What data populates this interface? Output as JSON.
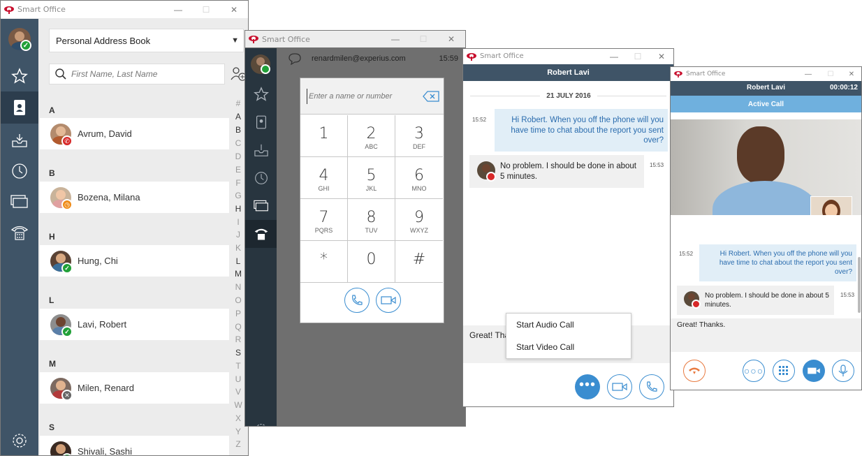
{
  "app": {
    "title": "Smart Office"
  },
  "colors": {
    "nav": "#3f5467",
    "accent": "#3a8dd0",
    "online": "#21a038",
    "busy": "#d72828",
    "away": "#ef8b18",
    "bubble": "#e1eef7"
  },
  "address_book": {
    "selector_value": "Personal Address Book",
    "search_placeholder": "First Name, Last Name",
    "sections": [
      {
        "letter": "A",
        "contact": "Avrum, David",
        "status": "busy"
      },
      {
        "letter": "B",
        "contact": "Bozena, Milana",
        "status": "away"
      },
      {
        "letter": "H",
        "contact": "Hung, Chi",
        "status": "online"
      },
      {
        "letter": "L",
        "contact": "Lavi, Robert",
        "status": "online"
      },
      {
        "letter": "M",
        "contact": "Milen, Renard",
        "status": "offline"
      },
      {
        "letter": "S",
        "contact": "Shivali, Sashi",
        "status": "online"
      }
    ],
    "alphabet": [
      "#",
      "A",
      "B",
      "C",
      "D",
      "E",
      "F",
      "G",
      "H",
      "I",
      "J",
      "K",
      "L",
      "M",
      "N",
      "O",
      "P",
      "Q",
      "R",
      "S",
      "T",
      "U",
      "V",
      "W",
      "X",
      "Y",
      "Z"
    ],
    "alphabet_active": [
      "A",
      "B",
      "H",
      "L",
      "M",
      "S"
    ]
  },
  "dialer": {
    "account": "renardmilen@experius.com",
    "time": "15:59",
    "input_placeholder": "Enter a name or number",
    "keys": [
      {
        "d": "1",
        "l": ""
      },
      {
        "d": "2",
        "l": "ABC"
      },
      {
        "d": "3",
        "l": "DEF"
      },
      {
        "d": "4",
        "l": "GHI"
      },
      {
        "d": "5",
        "l": "JKL"
      },
      {
        "d": "6",
        "l": "MNO"
      },
      {
        "d": "7",
        "l": "PQRS"
      },
      {
        "d": "8",
        "l": "TUV"
      },
      {
        "d": "9",
        "l": "WXYZ"
      },
      {
        "d": "*",
        "l": ""
      },
      {
        "d": "0",
        "l": ""
      },
      {
        "d": "#",
        "l": ""
      }
    ]
  },
  "chat": {
    "contact": "Robert Lavi",
    "date": "21 JULY 2016",
    "messages": [
      {
        "time": "15:52",
        "text": "Hi Robert. When you off the phone will you have time to chat about the report you sent over?",
        "own": true
      },
      {
        "time": "15:53",
        "text": "No problem. I should be done in about 5 minutes.",
        "own": false
      }
    ],
    "draft": "Great! Tha",
    "menu": [
      "Start Audio Call",
      "Start Video Call"
    ]
  },
  "call": {
    "contact": "Robert Lavi",
    "timer": "00:00:12",
    "status": "Active Call",
    "messages": [
      {
        "time": "15:52",
        "text": "Hi Robert. When you off the phone will you have time to chat about the report you sent over?"
      },
      {
        "time": "15:53",
        "text": "No problem. I should be done in about 5 minutes."
      }
    ],
    "draft": "Great! Thanks."
  }
}
